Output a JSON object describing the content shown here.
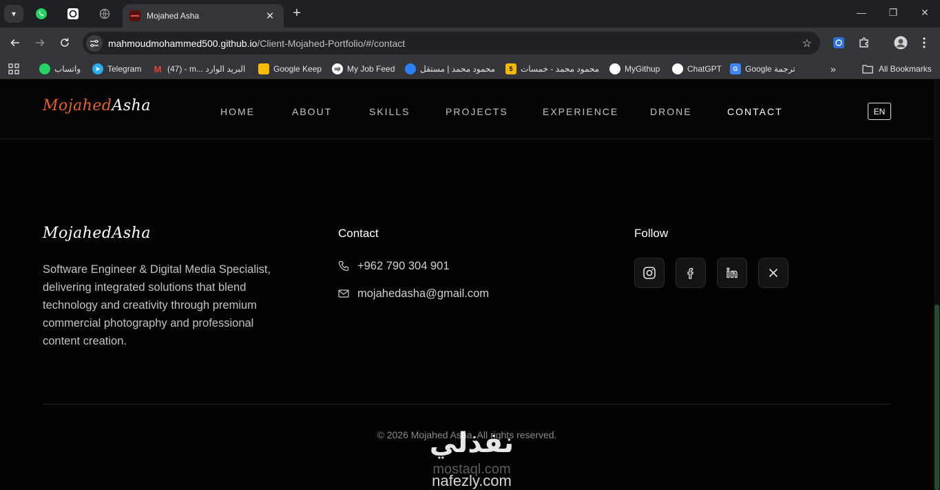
{
  "browser": {
    "active_tab_title": "Mojahed Asha",
    "url_host": "mahmoudmohammed500.github.io",
    "url_path": "/Client-Mojahed-Portfolio/#/contact",
    "bookmarks": [
      {
        "label": "واتساب",
        "icon": "whatsapp-icon",
        "color": "#25d366"
      },
      {
        "label": "Telegram",
        "icon": "telegram-icon",
        "color": "#2aabee"
      },
      {
        "label": "(47) - m... البريد الوارد",
        "icon": "gmail-icon",
        "color": "#ea4335"
      },
      {
        "label": "Google Keep",
        "icon": "keep-icon",
        "color": "#fbbc04"
      },
      {
        "label": "My Job Feed",
        "icon": "upwork-icon",
        "color": "#ffffff"
      },
      {
        "label": "محمود محمد | مستقل",
        "icon": "mostaql-icon",
        "color": "#2d7ff9"
      },
      {
        "label": "محمود محمد - خمسات",
        "icon": "khamsat-icon",
        "color": "#f6b700"
      },
      {
        "label": "MyGithup",
        "icon": "github-icon",
        "color": "#ffffff"
      },
      {
        "label": "ChatGPT",
        "icon": "chatgpt-icon",
        "color": "#ffffff"
      },
      {
        "label": "Google ترجمة",
        "icon": "translate-icon",
        "color": "#4285f4"
      }
    ],
    "all_bookmarks": "All Bookmarks",
    "overflow": "»"
  },
  "site": {
    "logo": {
      "first": "Mojahed",
      "last": "Asha"
    },
    "nav": [
      "HOME",
      "ABOUT",
      "SKILLS",
      "PROJECTS",
      "EXPERIENCE",
      "DRONE",
      "CONTACT"
    ],
    "active_nav": "CONTACT",
    "lang": "EN",
    "accent": "#e2622a"
  },
  "footer": {
    "about": "Software Engineer & Digital Media Specialist, delivering integrated solutions that blend technology and creativity through premium commercial photography and professional content creation.",
    "contact_title": "Contact",
    "phone": "+962 790 304 901",
    "email": "mojahedasha@gmail.com",
    "follow_title": "Follow",
    "socials": [
      "instagram-icon",
      "facebook-icon",
      "linkedin-icon",
      "x-icon"
    ],
    "copyright": "© 2026 Mojahed Asha. All rights reserved."
  },
  "watermark": {
    "arabic": "نفذلي",
    "line1": "mostaql.com",
    "line2": "nafezly.com"
  }
}
